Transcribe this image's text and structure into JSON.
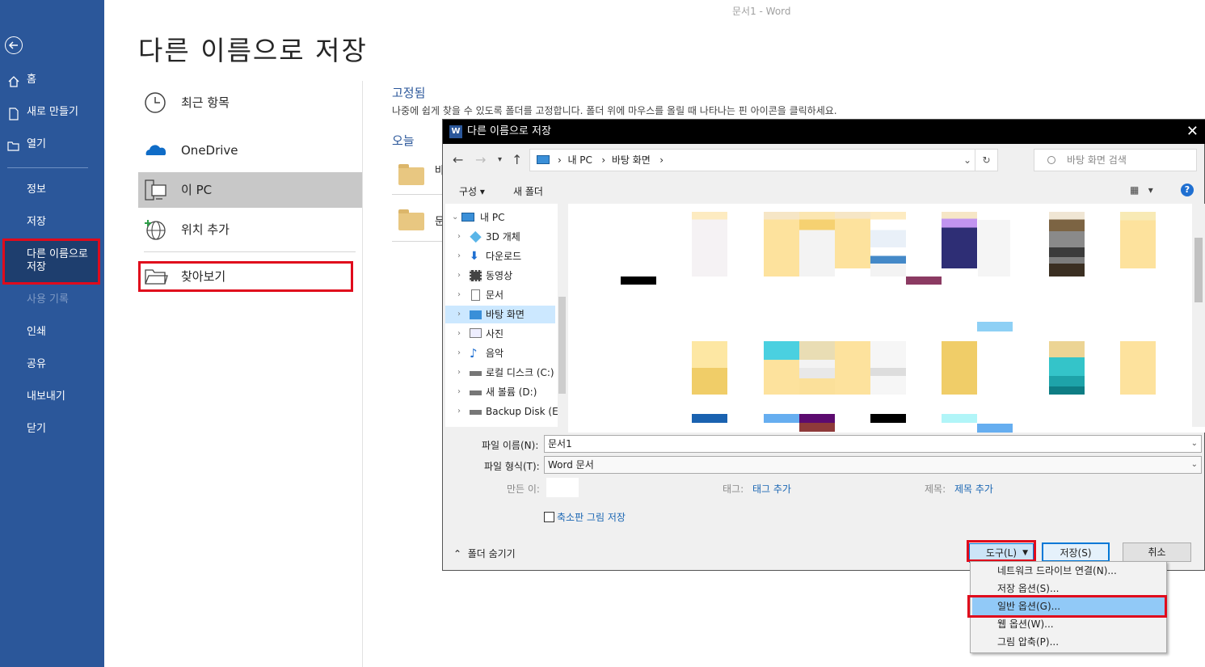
{
  "window": {
    "title": "문서1  -  Word"
  },
  "nav": {
    "items": [
      {
        "label": "홈",
        "icon": "home-icon"
      },
      {
        "label": "새로 만들기",
        "icon": "new-document-icon"
      },
      {
        "label": "열기",
        "icon": "open-folder-icon"
      },
      {
        "label": "정보"
      },
      {
        "label": "저장"
      },
      {
        "label": "다른 이름으로\n저장",
        "selected": true
      },
      {
        "label": "사용 기록",
        "disabled": true
      },
      {
        "label": "인쇄"
      },
      {
        "label": "공유"
      },
      {
        "label": "내보내기"
      },
      {
        "label": "닫기"
      }
    ]
  },
  "page": {
    "title": "다른 이름으로 저장",
    "locations": [
      {
        "label": "최근 항목",
        "icon": "clock-icon"
      },
      {
        "label": "OneDrive",
        "icon": "onedrive-cloud-icon"
      },
      {
        "label": "이 PC",
        "icon": "this-pc-icon",
        "selected": true
      },
      {
        "label": "위치 추가",
        "icon": "add-place-icon"
      },
      {
        "label": "찾아보기",
        "icon": "browse-folder-icon"
      }
    ],
    "pinned_head": "고정됨",
    "pinned_desc": "나중에 쉽게 찾을 수 있도록 폴더를 고정합니다. 폴더 위에 마우스를 올릴 때 나타나는 핀 아이콘을 클릭하세요.",
    "today_head": "오늘",
    "recent_folders": [
      "바",
      "문"
    ]
  },
  "dialog": {
    "title": "다른 이름으로 저장",
    "address": {
      "parts": [
        "내 PC",
        "바탕 화면"
      ]
    },
    "search_placeholder": "바탕 화면 검색",
    "toolbar": {
      "organize": "구성 ▾",
      "new_folder": "새 폴더",
      "help": "?"
    },
    "tree": {
      "root": "내 PC",
      "items": [
        {
          "label": "3D 개체",
          "icon": "3d-objects-icon"
        },
        {
          "label": "다운로드",
          "icon": "download-icon"
        },
        {
          "label": "동영상",
          "icon": "video-icon"
        },
        {
          "label": "문서",
          "icon": "documents-icon"
        },
        {
          "label": "바탕 화면",
          "icon": "desktop-icon",
          "selected": true
        },
        {
          "label": "사진",
          "icon": "pictures-icon"
        },
        {
          "label": "음악",
          "icon": "music-icon"
        },
        {
          "label": "로컬 디스크 (C:)",
          "icon": "local-disk-icon"
        },
        {
          "label": "새 볼륨 (D:)",
          "icon": "drive-icon"
        },
        {
          "label": "Backup Disk (E:)",
          "icon": "drive-icon"
        }
      ]
    },
    "form": {
      "filename_label": "파일 이름(N):",
      "filename_value": "문서1",
      "filetype_label": "파일 형식(T):",
      "filetype_value": "Word 문서",
      "author_label": "만든 이:",
      "tags_label": "태그:",
      "tags_link": "태그 추가",
      "title_label": "제목:",
      "title_link": "제목 추가",
      "thumbnail_label": "축소판 그림 저장",
      "hide_folders": "폴더 숨기기"
    },
    "buttons": {
      "tools": "도구(L)",
      "save": "저장(S)",
      "cancel": "취소"
    }
  },
  "tools_menu": {
    "items": [
      {
        "label": "네트워크 드라이브 연결(N)..."
      },
      {
        "label": "저장 옵션(S)..."
      },
      {
        "label": "일반 옵션(G)...",
        "highlighted": true
      },
      {
        "label": "웹 옵션(W)..."
      },
      {
        "label": "그림 압축(P)..."
      }
    ]
  }
}
